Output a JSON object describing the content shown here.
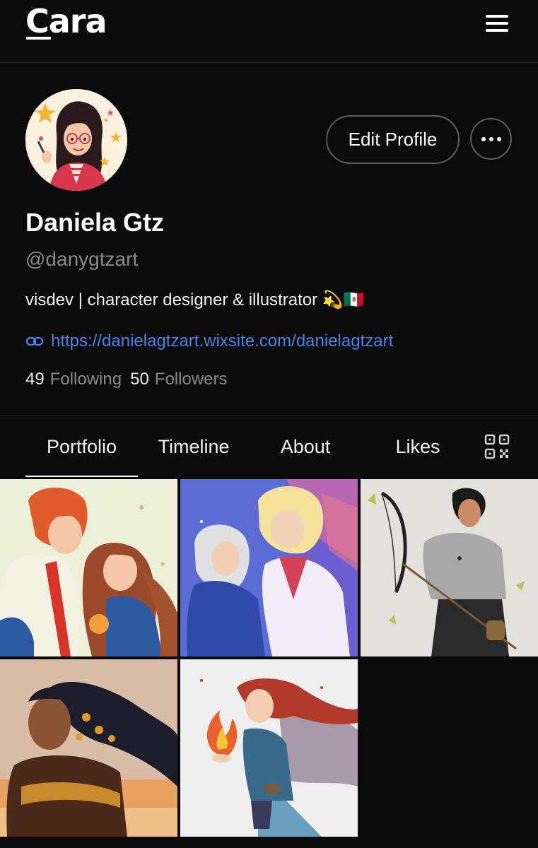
{
  "app": {
    "logo_text": "Cara"
  },
  "profile": {
    "name": "Daniela Gtz",
    "handle": "@danygtzart",
    "bio": "visdev | character designer & illustrator 💫🇲🇽",
    "link": "https://danielagtzart.wixsite.com/danielagtzart",
    "following_count": "49",
    "following_label": "Following",
    "followers_count": "50",
    "followers_label": "Followers",
    "edit_button_label": "Edit Profile"
  },
  "tabs": [
    {
      "label": "Portfolio",
      "active": true
    },
    {
      "label": "Timeline",
      "active": false
    },
    {
      "label": "About",
      "active": false
    },
    {
      "label": "Likes",
      "active": false
    }
  ],
  "icons": {
    "menu": "hamburger-menu-icon",
    "more": "more-horizontal-icon",
    "link": "link-icon",
    "qr": "qr-code-icon"
  },
  "colors": {
    "background": "#0b0b0b",
    "link": "#4d84e8",
    "muted_text": "#8a8a8a",
    "border": "#5e5e5e"
  },
  "portfolio": {
    "item_count": 5
  }
}
